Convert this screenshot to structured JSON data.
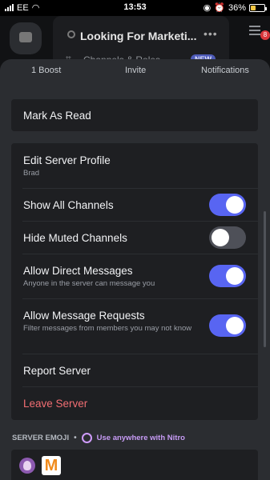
{
  "status_bar": {
    "carrier": "EE",
    "time": "13:53",
    "battery": "36%",
    "battery_level": 0.36
  },
  "background": {
    "server_title": "Looking For Marketi...",
    "channels_label": "Channels & Roles",
    "new_badge": "NEW",
    "notification_count": "8"
  },
  "actions": {
    "boost": "1 Boost",
    "invite": "Invite",
    "notifications": "Notifications"
  },
  "menu": {
    "mark_as_read": "Mark As Read",
    "edit_profile": {
      "label": "Edit Server Profile",
      "sub": "Brad"
    },
    "show_all_channels": {
      "label": "Show All Channels",
      "on": true
    },
    "hide_muted_channels": {
      "label": "Hide Muted Channels",
      "on": false
    },
    "allow_direct_messages": {
      "label": "Allow Direct Messages",
      "sub": "Anyone in the server can message you",
      "on": true
    },
    "allow_message_requests": {
      "label": "Allow Message Requests",
      "sub": "Filter messages from members you may not know",
      "on": true
    },
    "report_server": "Report Server",
    "leave_server": "Leave Server"
  },
  "emoji_section": {
    "header": "SERVER EMOJI",
    "separator": "•",
    "nitro_text": "Use anywhere with Nitro",
    "emoji2_glyph": "M"
  },
  "colors": {
    "accent": "#5865f2",
    "danger": "#f26e73",
    "nitro": "#c79bf5"
  }
}
